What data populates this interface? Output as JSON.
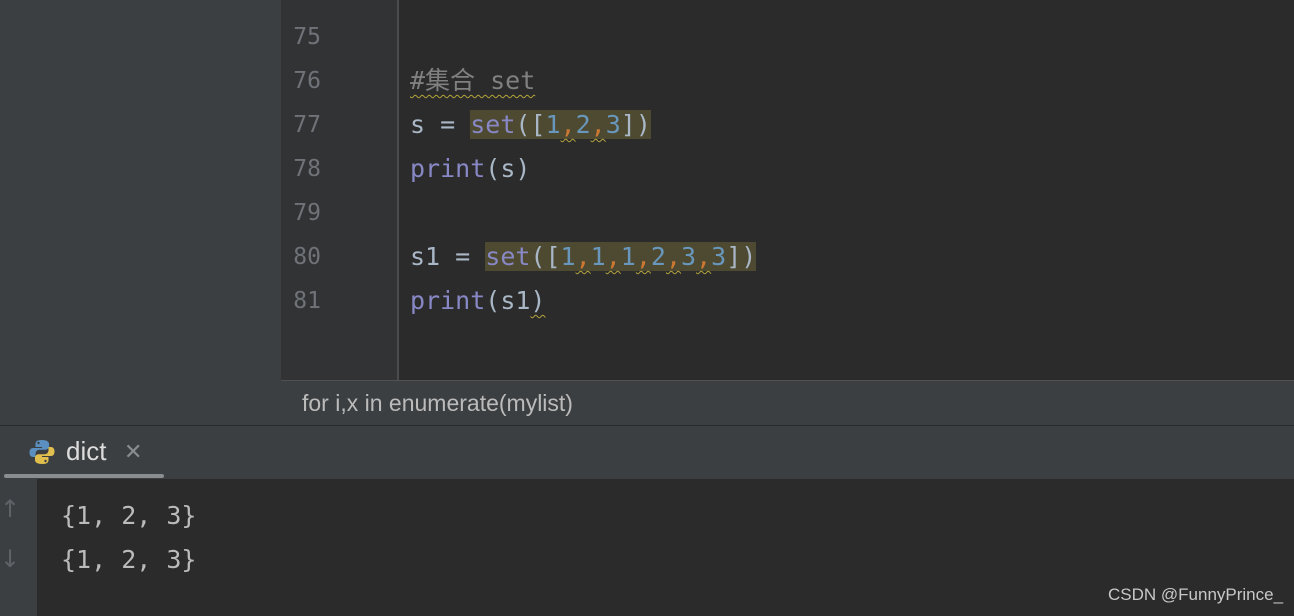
{
  "editor": {
    "lines": [
      {
        "num": "75"
      },
      {
        "num": "76",
        "comment": "#集合 set"
      },
      {
        "num": "77",
        "var": "s = ",
        "fn": "set",
        "open": "([",
        "vals": [
          "1",
          "2",
          "3"
        ],
        "sep": ",",
        "close": "])"
      },
      {
        "num": "78",
        "fn": "print",
        "args": "(s)"
      },
      {
        "num": "79"
      },
      {
        "num": "80",
        "var": "s1 = ",
        "fn": "set",
        "open": "([",
        "vals": [
          "1",
          "1",
          "1",
          "2",
          "3",
          "3"
        ],
        "sep": ",",
        "close": "])"
      },
      {
        "num": "81",
        "fn": "print",
        "args": "(s1",
        "close_paren": ")"
      }
    ]
  },
  "breadcrumb": {
    "text": "for i,x in enumerate(mylist)"
  },
  "run_panel": {
    "tab_label": "dict",
    "tab_close_glyph": "✕",
    "console_lines": [
      "{1, 2, 3}",
      "{1, 2, 3}"
    ]
  },
  "watermark": "CSDN @FunnyPrince_",
  "colors": {
    "keyword_fn": "#8888c6",
    "number": "#6897bb",
    "comma": "#cc7832",
    "comment": "#808080",
    "highlight": "#4e4a32"
  }
}
